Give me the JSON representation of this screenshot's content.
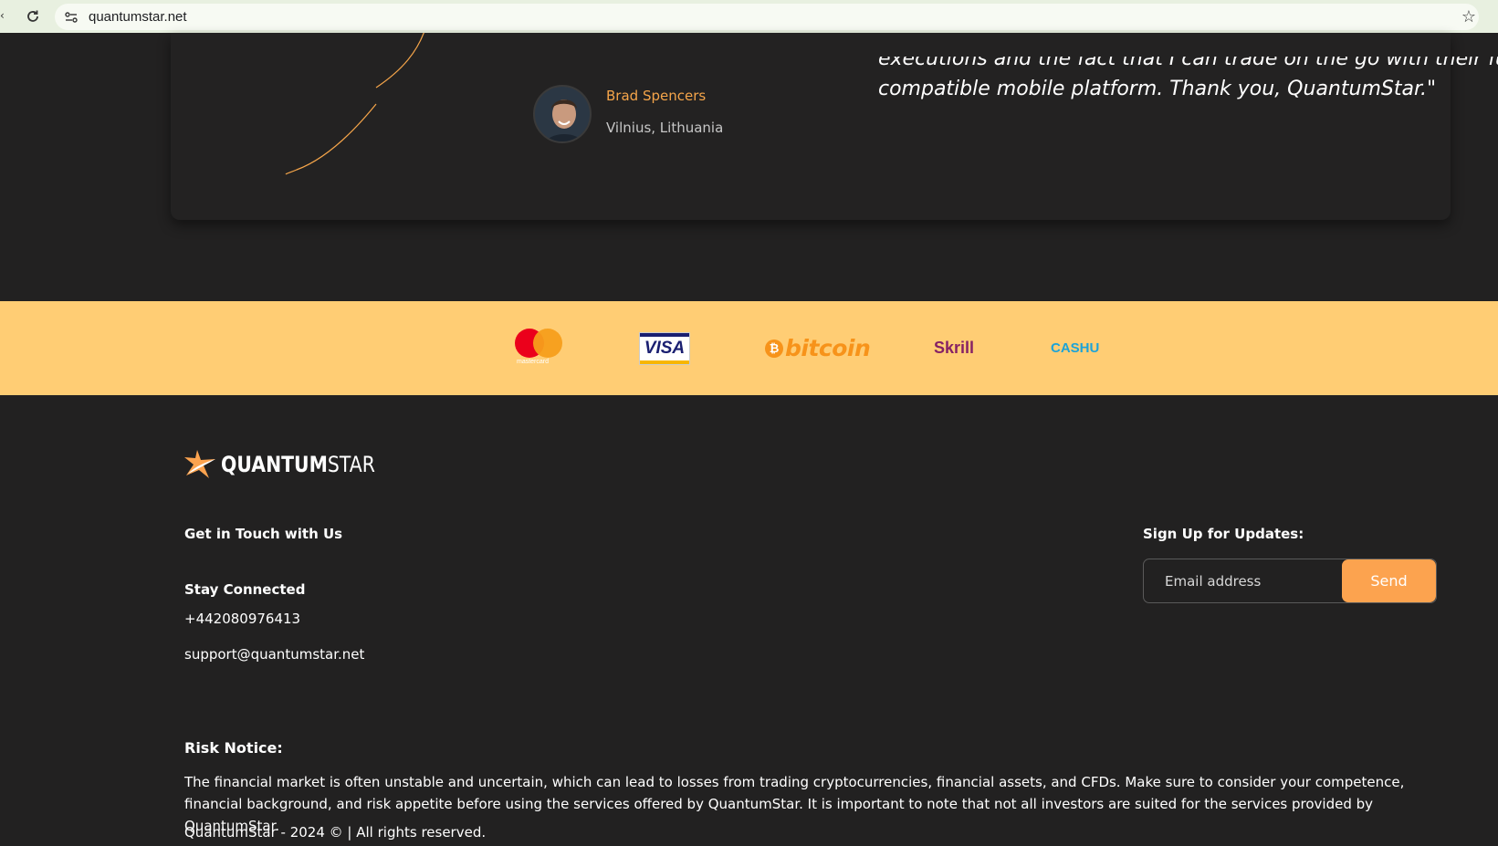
{
  "browser": {
    "url": "quantumstar.net"
  },
  "testimonial": {
    "author_name": "Brad Spencers",
    "author_location": "Vilnius, Lithuania",
    "quote_line1": "executions and the fact that I can trade on the go with their fully",
    "quote_line2": "compatible mobile platform. Thank you, QuantumStar.\""
  },
  "payments": {
    "mastercard_label": "mastercard",
    "visa_label": "VISA",
    "bitcoin_symbol": "₿",
    "bitcoin_label": "bitcoin",
    "skrill_label": "Skrill",
    "cashu_label": "CASHU"
  },
  "footer": {
    "brand_bold": "QUANTUM",
    "brand_light": "STAR",
    "get_in_touch": "Get in Touch with Us",
    "stay_connected": "Stay Connected",
    "phone": "+442080976413",
    "email": "support@quantumstar.net",
    "signup_heading": "Sign Up for Updates:",
    "email_placeholder": "Email address",
    "send_label": "Send",
    "risk_heading": "Risk Notice:",
    "risk_text": "The financial market is often unstable and uncertain, which can lead to losses from trading cryptocurrencies, financial assets, and CFDs. Make sure to consider your competence, financial background, and risk appetite before using the services offered by QuantumStar. It is important to note that not all investors are suited for the services provided by QuantumStar.",
    "copyright": "QuantumStar - 2024 © | All rights reserved."
  },
  "colors": {
    "accent": "#fca34f",
    "band": "#ffcd74",
    "background": "#222121"
  }
}
